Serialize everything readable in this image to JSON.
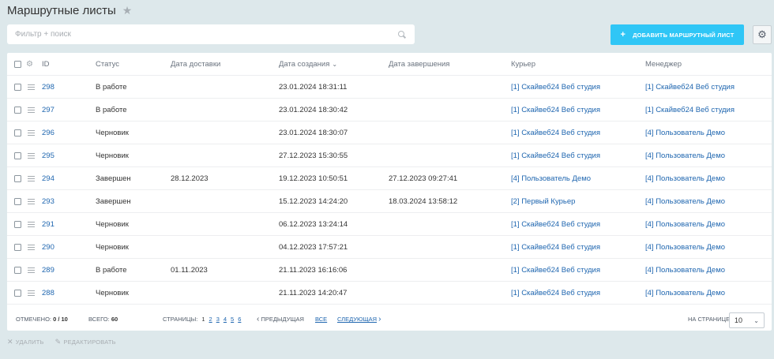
{
  "page": {
    "title": "Маршрутные листы"
  },
  "toolbar": {
    "filter_placeholder": "Фильтр + поиск",
    "add_button_label": "ДОБАВИТЬ МАРШРУТНЫЙ ЛИСТ"
  },
  "table": {
    "headers": {
      "id": "ID",
      "status": "Статус",
      "delivery_date": "Дата доставки",
      "created_date": "Дата создания",
      "finished_date": "Дата завершения",
      "courier": "Курьер",
      "manager": "Менеджер"
    },
    "rows": [
      {
        "id": "298",
        "status": "В работе",
        "delivery": "",
        "created": "23.01.2024 18:31:11",
        "finished": "",
        "courier": "[1] Скайвеб24 Веб студия",
        "manager": "[1] Скайвеб24 Веб студия"
      },
      {
        "id": "297",
        "status": "В работе",
        "delivery": "",
        "created": "23.01.2024 18:30:42",
        "finished": "",
        "courier": "[1] Скайвеб24 Веб студия",
        "manager": "[1] Скайвеб24 Веб студия"
      },
      {
        "id": "296",
        "status": "Черновик",
        "delivery": "",
        "created": "23.01.2024 18:30:07",
        "finished": "",
        "courier": "[1] Скайвеб24 Веб студия",
        "manager": "[4] Пользователь Демо"
      },
      {
        "id": "295",
        "status": "Черновик",
        "delivery": "",
        "created": "27.12.2023 15:30:55",
        "finished": "",
        "courier": "[1] Скайвеб24 Веб студия",
        "manager": "[4] Пользователь Демо"
      },
      {
        "id": "294",
        "status": "Завершен",
        "delivery": "28.12.2023",
        "created": "19.12.2023 10:50:51",
        "finished": "27.12.2023 09:27:41",
        "courier": "[4] Пользователь Демо",
        "manager": "[4] Пользователь Демо"
      },
      {
        "id": "293",
        "status": "Завершен",
        "delivery": "",
        "created": "15.12.2023 14:24:20",
        "finished": "18.03.2024 13:58:12",
        "courier": "[2] Первый Курьер",
        "manager": "[4] Пользователь Демо"
      },
      {
        "id": "291",
        "status": "Черновик",
        "delivery": "",
        "created": "06.12.2023 13:24:14",
        "finished": "",
        "courier": "[1] Скайвеб24 Веб студия",
        "manager": "[4] Пользователь Демо"
      },
      {
        "id": "290",
        "status": "Черновик",
        "delivery": "",
        "created": "04.12.2023 17:57:21",
        "finished": "",
        "courier": "[1] Скайвеб24 Веб студия",
        "manager": "[4] Пользователь Демо"
      },
      {
        "id": "289",
        "status": "В работе",
        "delivery": "01.11.2023",
        "created": "21.11.2023 16:16:06",
        "finished": "",
        "courier": "[1] Скайвеб24 Веб студия",
        "manager": "[4] Пользователь Демо"
      },
      {
        "id": "288",
        "status": "Черновик",
        "delivery": "",
        "created": "21.11.2023 14:20:47",
        "finished": "",
        "courier": "[1] Скайвеб24 Веб студия",
        "manager": "[4] Пользователь Демо"
      }
    ]
  },
  "footer": {
    "selected_label": "ОТМЕЧЕНО:",
    "selected_value": "0 / 10",
    "total_label": "ВСЕГО:",
    "total_value": "60",
    "pages_label": "СТРАНИЦЫ:",
    "pages": [
      "1",
      "2",
      "3",
      "4",
      "5",
      "6"
    ],
    "current_page": "1",
    "prev_label": "ПРЕДЫДУЩАЯ",
    "all_label": "ВСЕ",
    "next_label": "СЛЕДУЮЩАЯ",
    "per_page_label": "НА СТРАНИЦЕ:",
    "per_page_value": "10"
  },
  "actions": {
    "delete_label": "УДАЛИТЬ",
    "edit_label": "РЕДАКТИРОВАТЬ"
  },
  "icons": {
    "star": "star-icon",
    "search": "search-icon",
    "plus": "plus-icon",
    "settings": "gear-icon",
    "row_menu": "menu-icon",
    "sort": "sort-down-icon",
    "prev": "chevron-left-icon",
    "next": "chevron-right-icon",
    "select": "chevron-down-icon",
    "delete": "x-icon",
    "edit": "pencil-icon"
  },
  "colors": {
    "accent": "#2fc6f6",
    "link": "#2067b0",
    "background": "#dde8eb"
  }
}
